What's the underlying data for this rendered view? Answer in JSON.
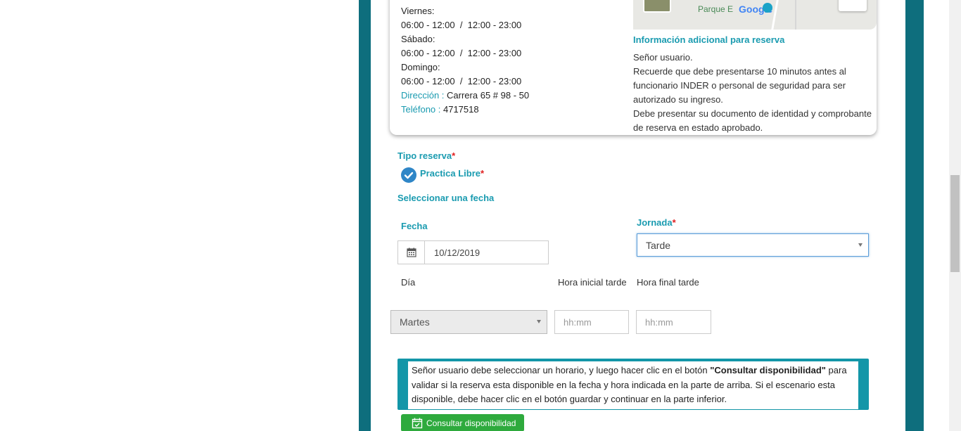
{
  "schedule": {
    "days": [
      {
        "day": "Viernes:",
        "hours": "06:00 - 12:00  /  12:00 - 23:00"
      },
      {
        "day": "Sábado:",
        "hours": "06:00 - 12:00  /  12:00 - 23:00"
      },
      {
        "day": "Domingo:",
        "hours": "06:00 - 12:00  /  12:00 - 23:00"
      }
    ],
    "address_label": "Dirección :",
    "address_value": " Carrera 65 # 98 - 50",
    "phone_label": "Teléfono :",
    "phone_value": " 4717518"
  },
  "map": {
    "place_label": "Parque E",
    "logo": "Google"
  },
  "additional_info": {
    "title": "Información adicional para reserva",
    "text": "Señor usuario.\nRecuerde que debe presentarse 10 minutos antes al funcionario INDER o personal de seguridad para ser autorizado su ingreso.\nDebe presentar su documento de identidad y comprobante de reserva en estado aprobado."
  },
  "form": {
    "tipo_reserva_label": "Tipo reserva",
    "required_mark": "*",
    "option_label": "Practica Libre",
    "select_date_heading": "Seleccionar una fecha",
    "fecha_label": "Fecha",
    "fecha_value": "10/12/2019",
    "jornada_label": "Jornada",
    "jornada_value": "Tarde",
    "dia_label": "Día",
    "hora_inicial_label": "Hora inicial tarde",
    "hora_final_label": "Hora final tarde",
    "dia_value": "Martes",
    "time_placeholder": "hh:mm"
  },
  "notice": {
    "part1": "Señor usuario debe seleccionar un horario, y luego hacer clic en el botón ",
    "bold": "\"Consultar disponibilidad\"",
    "part2": " para validar si la reserva esta disponible en la fecha y hora indicada en la parte de arriba. Si el escenario esta disponible, debe hacer clic en el botón guardar y continuar en la parte inferior."
  },
  "button": {
    "consultar_label": "Consultar disponibilidad"
  },
  "colors": {
    "frame": "#0e6e7d",
    "accent": "#1a9bb0",
    "button_green": "#2eaa3d"
  },
  "icons": {
    "calendar": "calendar-icon",
    "check": "check-circle-icon",
    "calendar_check": "calendar-check-icon"
  }
}
